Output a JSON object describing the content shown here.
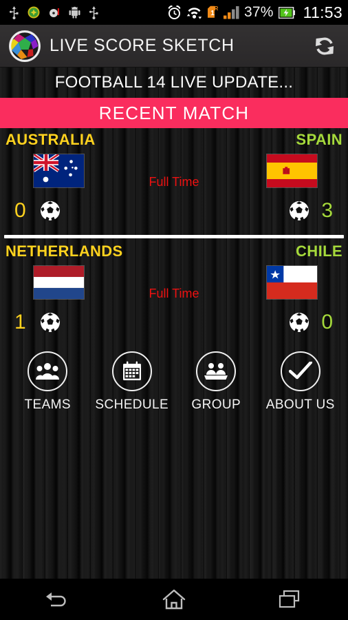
{
  "status_bar": {
    "left_icons": [
      "usb-icon",
      "green-badge-icon",
      "media-disc-icon",
      "android-robot-icon",
      "usb-icon"
    ],
    "alarm_icon": "alarm-clock-icon",
    "wifi_icon": "wifi-transfer-icon",
    "sim_icon": "sim-card-1-roaming-icon",
    "signal_icon": "signal-bars-icon",
    "battery_percent": "37%",
    "battery_icon": "battery-charging-icon",
    "time": "11:53"
  },
  "app_bar": {
    "logo": "colored-soccer-ball-logo",
    "title": "LIVE SCORE SKETCH",
    "refresh_icon": "refresh-icon"
  },
  "headline": "FOOTBALL 14 LIVE UPDATE...",
  "recent_banner": {
    "label": "RECENT MATCH",
    "bg_color": "#FA2D5E"
  },
  "colors": {
    "home_team": "#FFD21E",
    "away_team": "#A5D93B",
    "status_text": "#EE1111",
    "banner": "#FA2D5E"
  },
  "matches": [
    {
      "home_team": "AUSTRALIA",
      "home_flag": "australia-flag",
      "home_score": "0",
      "away_team": "SPAIN",
      "away_flag": "spain-flag",
      "away_score": "3",
      "status": "Full Time"
    },
    {
      "home_team": "NETHERLANDS",
      "home_flag": "netherlands-flag",
      "home_score": "1",
      "away_team": "CHILE",
      "away_flag": "chile-flag",
      "away_score": "0",
      "status": "Full Time"
    }
  ],
  "nav_items": [
    {
      "label": "TEAMS",
      "icon": "people-group-icon"
    },
    {
      "label": "SCHEDULE",
      "icon": "calendar-icon"
    },
    {
      "label": "GROUP",
      "icon": "group-table-icon"
    },
    {
      "label": "ABOUT US",
      "icon": "checkmark-icon"
    }
  ],
  "android_nav": {
    "back": "back-arrow-icon",
    "home": "home-icon",
    "recents": "recent-apps-icon"
  }
}
